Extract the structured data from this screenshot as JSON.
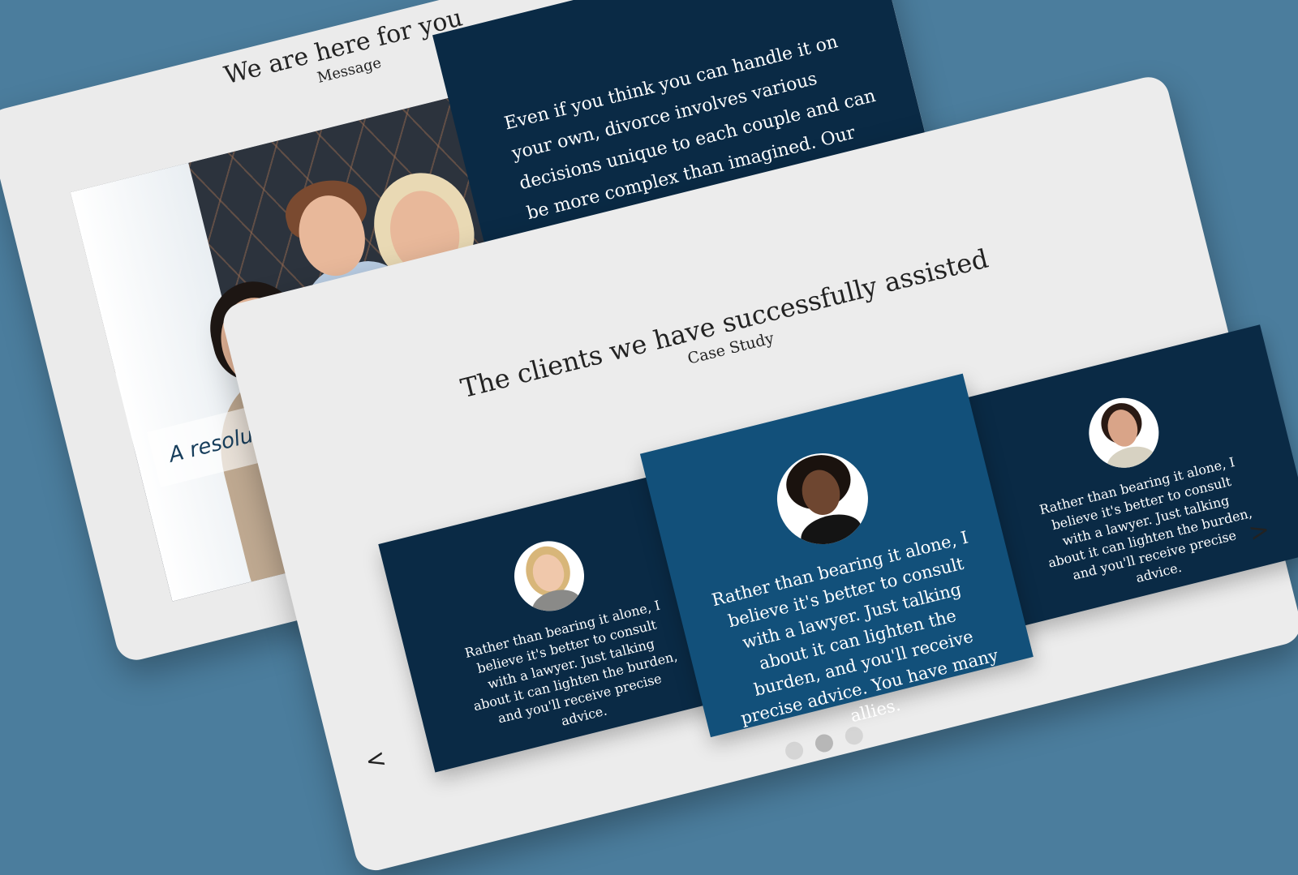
{
  "message_section": {
    "heading": "We are here for you",
    "subheading": "Message",
    "body": "Even if you think you can handle it on your own, divorce involves various decisions unique to each couple and can be more complex than imagined. Our attorneys empathize with your",
    "image_caption": "A resolution that sa"
  },
  "case_study_section": {
    "heading": "The clients we have successfully assisted",
    "subheading": "Case Study",
    "slides": [
      {
        "text": "Rather than bearing it alone, I believe it's better to consult with a lawyer. Just talking about it can lighten the burden, and you'll receive precise advice."
      },
      {
        "text": "Rather than bearing it alone, I believe it's better to consult with a lawyer. Just talking about it can lighten the burden, and you'll receive precise advice. You have many allies."
      },
      {
        "text": "Rather than bearing it alone, I believe it's better to consult with a lawyer. Just talking about it can lighten the burden, and you'll receive precise advice."
      }
    ],
    "prev_label": "<",
    "next_label": ">",
    "pagination": {
      "count": 3,
      "active_index": 1
    }
  },
  "colors": {
    "background": "#4b7d9d",
    "card": "#ececec",
    "navy": "#0a2a45",
    "accent_blue": "#12507a"
  }
}
